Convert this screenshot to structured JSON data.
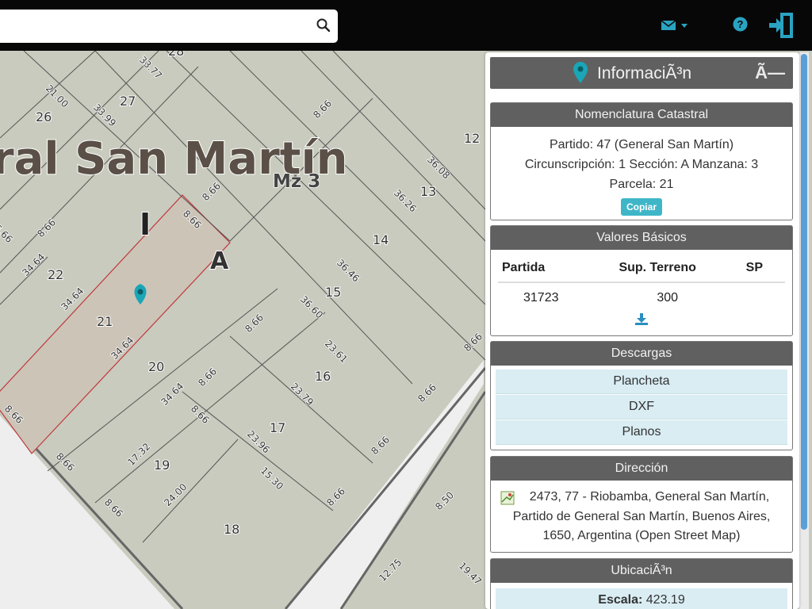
{
  "search": {
    "value": "",
    "placeholder": ""
  },
  "top_icons": [
    "mail-icon",
    "help-icon",
    "logout-icon"
  ],
  "map": {
    "locality": "ral San Martín",
    "block_label": "Mz 3",
    "section_I": "I",
    "section_A": "A",
    "parcels": [
      "28",
      "27",
      "26",
      "12",
      "13",
      "14",
      "15",
      "16",
      "17",
      "18",
      "19",
      "20",
      "21",
      "22"
    ],
    "dimensions": [
      "33.77",
      "21.00",
      "33.99",
      "8.66",
      "8.66",
      "36.08",
      "36.26",
      "8.66",
      "34.64",
      "8.66",
      "34.64",
      "36.46",
      "36.60",
      "34.64",
      "8.66",
      "23.61",
      "8.66",
      "8.66",
      "34.64",
      "8.66",
      "23.79",
      "8.66",
      "17.32",
      "8.66",
      "23.96",
      "8.66",
      "24.00",
      "15.30",
      "8.66",
      "8.66",
      "8.50",
      "12.75",
      "19.47",
      "8.66",
      "6.66"
    ]
  },
  "panel": {
    "title": "InformaciÃ³n",
    "close_glyph": "Ã—",
    "nomenclatura": {
      "heading": "Nomenclatura Catastral",
      "line1": "Partido: 47 (General San Martín)",
      "line2": "Circunscripción: 1 Sección: A Manzana: 3",
      "line3": "Parcela: 21",
      "copy_label": "Copiar"
    },
    "valores": {
      "heading": "Valores Básicos",
      "columns": [
        "Partida",
        "Sup. Terreno",
        "SP"
      ],
      "row": [
        "31723",
        "300",
        ""
      ]
    },
    "descargas": {
      "heading": "Descargas",
      "items": [
        "Plancheta",
        "DXF",
        "Planos"
      ]
    },
    "direccion": {
      "heading": "Dirección",
      "line1": "2473, 77 - Riobamba, General San Martín,",
      "line2": "Partido de General San Martín, Buenos Aires,",
      "line3": "1650, Argentina (Open Street Map)"
    },
    "ubicacion": {
      "heading": "UbicaciÃ³n",
      "scale_label": "Escala:",
      "scale_value": "423.19"
    }
  },
  "colors": {
    "accent": "#3fb6c8",
    "header": "#606060",
    "map_bg": "#c8cbbe",
    "parcel_highlight": "#cdc4b8",
    "parcel_border": "#c0383a"
  }
}
